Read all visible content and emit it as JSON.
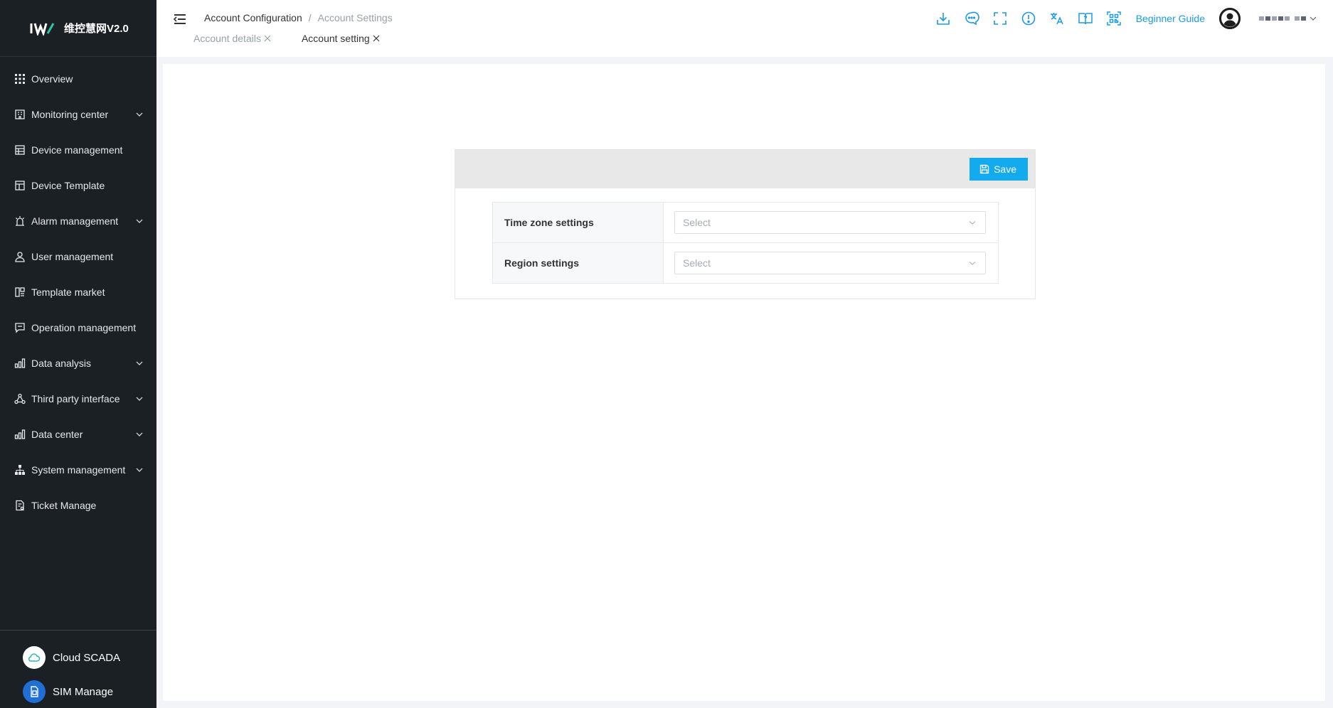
{
  "app": {
    "logo_text": "维控慧网V2.0"
  },
  "sidebar": {
    "items": [
      {
        "label": "Overview",
        "icon": "grid-icon",
        "has_submenu": false
      },
      {
        "label": "Monitoring center",
        "icon": "building-icon",
        "has_submenu": true
      },
      {
        "label": "Device management",
        "icon": "device-list-icon",
        "has_submenu": false
      },
      {
        "label": "Device Template",
        "icon": "template-icon",
        "has_submenu": false
      },
      {
        "label": "Alarm management",
        "icon": "alarm-icon",
        "has_submenu": true
      },
      {
        "label": "User management",
        "icon": "user-icon",
        "has_submenu": false
      },
      {
        "label": "Template market",
        "icon": "market-icon",
        "has_submenu": false
      },
      {
        "label": "Operation management",
        "icon": "chat-screen-icon",
        "has_submenu": false
      },
      {
        "label": "Data analysis",
        "icon": "bar-chart-icon",
        "has_submenu": true
      },
      {
        "label": "Third party interface",
        "icon": "network-icon",
        "has_submenu": true
      },
      {
        "label": "Data center",
        "icon": "bar-chart-icon",
        "has_submenu": true
      },
      {
        "label": "System management",
        "icon": "hierarchy-icon",
        "has_submenu": true
      },
      {
        "label": "Ticket Manage",
        "icon": "ticket-icon",
        "has_submenu": false
      }
    ],
    "bottom": [
      {
        "label": "Cloud SCADA",
        "icon": "cloud-icon"
      },
      {
        "label": "SIM Manage",
        "icon": "sim-card-icon"
      }
    ]
  },
  "header": {
    "breadcrumb": {
      "parent": "Account Configuration",
      "separator": "/",
      "current": "Account Settings"
    },
    "tabs": [
      {
        "label": "Account details",
        "active": false
      },
      {
        "label": "Account setting",
        "active": true
      }
    ],
    "toolbar_icons": [
      "download-icon",
      "message-icon",
      "fullscreen-icon",
      "info-icon",
      "translate-icon",
      "help-book-icon",
      "qr-code-icon"
    ],
    "guide_label": "Beginner Guide"
  },
  "form": {
    "save_label": "Save",
    "rows": [
      {
        "label": "Time zone settings",
        "placeholder": "Select"
      },
      {
        "label": "Region settings",
        "placeholder": "Select"
      }
    ]
  },
  "colors": {
    "sidebar_bg": "#1b2024",
    "accent": "#13aaee",
    "link": "#1a9be6",
    "panel_header_bg": "#e8e8e8"
  }
}
